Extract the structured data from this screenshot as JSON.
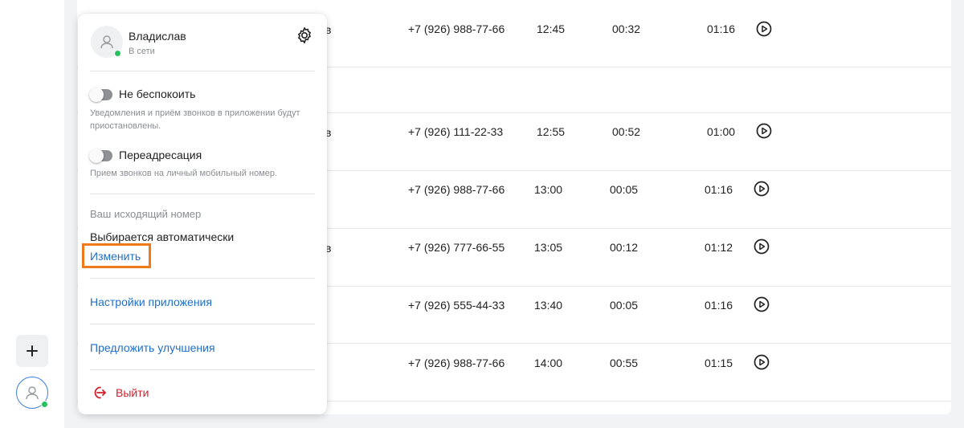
{
  "calls": [
    {
      "phone": "+7 (926) 988-77-66",
      "start": "12:45",
      "wait": "00:32",
      "duration": "01:16",
      "name_fragment": "в"
    },
    {
      "phone": "+7 (926) 111-22-33",
      "start": "12:55",
      "wait": "00:52",
      "duration": "01:00",
      "name_fragment": "в"
    },
    {
      "phone": "+7 (926) 988-77-66",
      "start": "13:00",
      "wait": "00:05",
      "duration": "01:16",
      "name_fragment": ""
    },
    {
      "phone": "+7 (926) 777-66-55",
      "start": "13:05",
      "wait": "00:12",
      "duration": "01:12",
      "name_fragment": "в"
    },
    {
      "phone": "+7 (926) 555-44-33",
      "start": "13:40",
      "wait": "00:05",
      "duration": "01:16",
      "name_fragment": ""
    },
    {
      "phone": "+7 (926) 988-77-66",
      "start": "14:00",
      "wait": "00:55",
      "duration": "01:15",
      "name_fragment": ""
    }
  ],
  "icons": {
    "play": "play-circle-icon",
    "add": "plus-icon",
    "avatar": "user-icon",
    "settings": "gear-icon",
    "logout": "logout-icon"
  },
  "profile": {
    "name": "Владислав",
    "status": "В сети"
  },
  "dnd": {
    "label": "Не беспокоить",
    "hint": "Уведомления и приём звонков в приложении будут приостановлены."
  },
  "forward": {
    "label": "Переадресация",
    "hint": "Прием звонков на личный мобильный номер."
  },
  "outgoing": {
    "title": "Ваш исходящий номер",
    "value": "Выбирается автоматически",
    "change_label": "Изменить"
  },
  "menu": {
    "app_settings": "Настройки приложения",
    "suggest": "Предложить улучшения",
    "logout": "Выйти"
  },
  "colors": {
    "link": "#1f6fc9",
    "logout": "#d0202c",
    "online": "#29c15d",
    "highlight": "#f07a1a"
  }
}
